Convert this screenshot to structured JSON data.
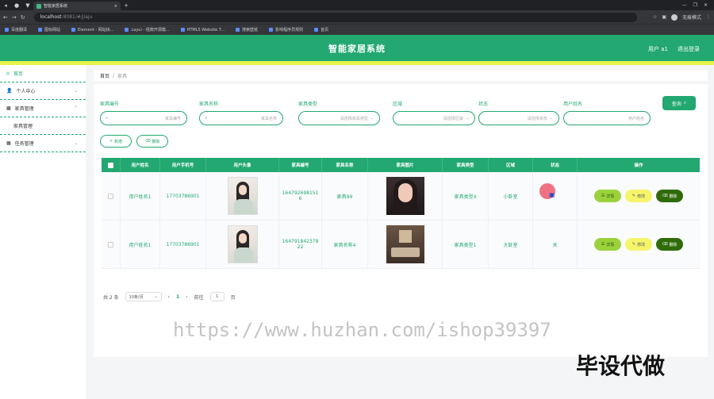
{
  "browser": {
    "tab_title": "智能家居系统",
    "url_host": "localhost",
    "url_rest": ":8081/#/jiaju",
    "profile": "无痕模式",
    "bookmarks": [
      "百度翻译",
      "图标网站",
      "Element - 网站快...",
      "Layui - 经典开源模...",
      "HTML5 Website T...",
      "搜索壁纸",
      "影响程序员规则",
      "首页"
    ]
  },
  "header": {
    "title": "智能家居系统",
    "user": "用户 a1",
    "logout": "退出登录"
  },
  "sidebar": {
    "items": [
      {
        "label": "首页",
        "icon": "home-icon"
      },
      {
        "label": "个人中心",
        "icon": "user-icon"
      },
      {
        "label": "家具管理",
        "icon": "grid-icon"
      },
      {
        "label": "任务管理",
        "icon": "grid-icon"
      }
    ],
    "sub_items": [
      "家具管理"
    ]
  },
  "breadcrumb": {
    "home": "首页",
    "sep": "/",
    "current": "家具"
  },
  "filters": {
    "code_label": "家具编号",
    "code_placeholder": "家具编号",
    "name_label": "家具名称",
    "name_placeholder": "家具名称",
    "type_label": "家具类型",
    "type_placeholder": "请选择家具类型",
    "area_label": "区域",
    "area_placeholder": "请选择区域",
    "status_label": "状态",
    "status_placeholder": "请选择状态",
    "username_label": "用户姓名",
    "username_placeholder": "用户姓名",
    "search_button": "查询"
  },
  "toolbar": {
    "add_label": "新增",
    "delete_label": "删除"
  },
  "table": {
    "headers": [
      "用户姓名",
      "用户手机号",
      "用户头像",
      "家具编号",
      "家具名称",
      "家具图片",
      "家具类型",
      "区域",
      "状态",
      "操作"
    ],
    "rows": [
      {
        "username": "用户姓名1",
        "phone": "17703786901",
        "code": "1647926981516",
        "name": "家具99",
        "type": "家具类型4",
        "area": "小卧室",
        "status": ""
      },
      {
        "username": "用户姓名1",
        "phone": "17703786901",
        "code": "164791842378 22",
        "name": "家具名称4",
        "type": "家具类型1",
        "area": "大卧室",
        "status": "关"
      }
    ],
    "actions": {
      "detail": "详情",
      "edit": "修改",
      "delete": "删除"
    }
  },
  "pager": {
    "total": "共 2 条",
    "page_size": "10条/页",
    "current": "1",
    "goto": "前往",
    "goto_value": "1",
    "page_unit": "页"
  },
  "watermark": {
    "url": "https://www.huzhan.com/ishop39397",
    "text": "毕设代做"
  },
  "colors": {
    "primary": "#22a870",
    "accent": "#e8f44a"
  }
}
